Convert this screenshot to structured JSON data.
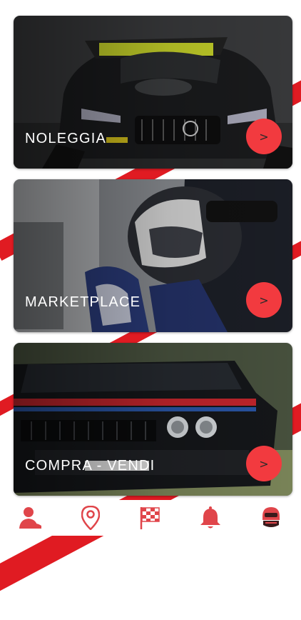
{
  "cards": [
    {
      "label": "NOLEGGIA",
      "action": ">"
    },
    {
      "label": "MARKETPLACE",
      "action": ">"
    },
    {
      "label": "COMPRA - VENDI",
      "action": ">"
    }
  ],
  "tabbar": {
    "icons": [
      "user-icon",
      "location-pin-icon",
      "checkered-flag-icon",
      "bell-icon",
      "driver-helmet-icon"
    ]
  },
  "colors": {
    "accent": "#e01b22",
    "button": "#f23a3f",
    "background": "#ffffff"
  }
}
